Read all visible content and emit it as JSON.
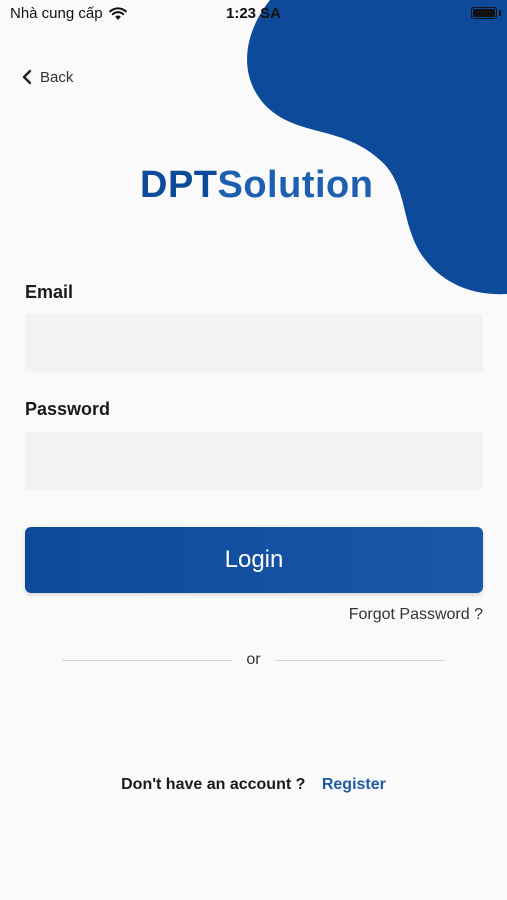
{
  "status_bar": {
    "carrier": "Nhà cung cấp",
    "time": "1:23 SA",
    "wifi_icon": "wifi-icon",
    "battery_icon": "battery-icon"
  },
  "nav": {
    "back_label": "Back",
    "back_icon": "chevron-left-icon"
  },
  "brand": {
    "part1": "DPT",
    "part2": "Solution",
    "color_primary": "#0E4A9A",
    "color_secondary": "#1F5FB0"
  },
  "form": {
    "email_label": "Email",
    "email_value": "",
    "password_label": "Password",
    "password_value": "",
    "login_label": "Login",
    "forgot_label": "Forgot Password ?"
  },
  "divider": {
    "text": "or"
  },
  "register": {
    "prompt": "Don't have an account ?",
    "link": "Register"
  },
  "colors": {
    "accent": "#0E4A9A",
    "link": "#1E5BA6",
    "background": "#FAFAFA",
    "input_bg": "#F3F3F3"
  }
}
